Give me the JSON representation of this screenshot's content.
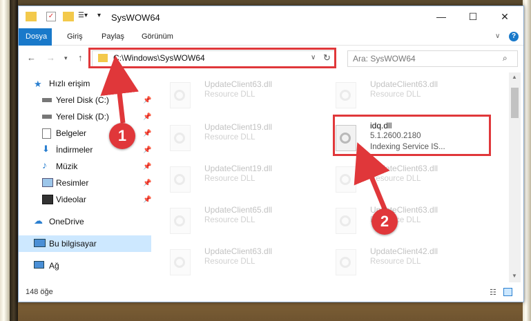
{
  "window": {
    "title": "SysWOW64"
  },
  "ribbon": {
    "tabs": [
      "Dosya",
      "Giriş",
      "Paylaş",
      "Görünüm"
    ]
  },
  "address": {
    "path": "C:\\Windows\\SysWOW64"
  },
  "search": {
    "placeholder": "Ara: SysWOW64"
  },
  "sidebar": {
    "quick_access": "Hızlı erişim",
    "items": [
      "Yerel Disk (C:)",
      "Yerel Disk (D:)",
      "Belgeler",
      "İndirmeler",
      "Müzik",
      "Resimler",
      "Videolar"
    ],
    "onedrive": "OneDrive",
    "this_pc": "Bu bilgisayar",
    "network": "Ağ"
  },
  "files": {
    "left": [
      {
        "name": "UpdateClient63.dll",
        "desc": "Resource DLL"
      },
      {
        "name": "UpdateClient19.dll",
        "desc": "Resource DLL"
      },
      {
        "name": "UpdateClient19.dll",
        "desc": "Resource DLL"
      },
      {
        "name": "UpdateClient65.dll",
        "desc": "Resource DLL"
      },
      {
        "name": "UpdateClient63.dll",
        "desc": "Resource DLL"
      }
    ],
    "right": [
      {
        "name": "UpdateClient63.dll",
        "desc": "Resource DLL"
      },
      {
        "name": "idq.dll",
        "version": "5.1.2600.2180",
        "desc": "Indexing Service IS..."
      },
      {
        "name": "UpdateClient63.dll",
        "desc": "Resource DLL"
      },
      {
        "name": "UpdateClient63.dll",
        "desc": "Resource DLL"
      },
      {
        "name": "UpdateClient42.dll",
        "desc": "Resource DLL"
      }
    ]
  },
  "status": {
    "count": "148 öğe"
  },
  "annotations": {
    "step1": "1",
    "step2": "2"
  },
  "colors": {
    "highlight": "#e0373a",
    "accent": "#1979ca"
  }
}
